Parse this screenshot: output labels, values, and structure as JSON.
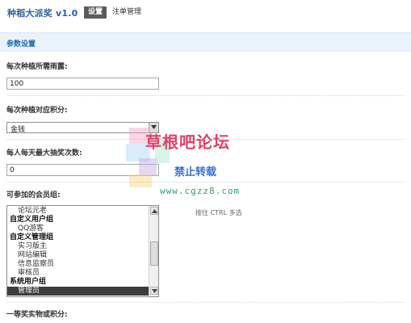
{
  "header": {
    "app_title": "种稻大派奖 v1.0",
    "tabs": [
      {
        "label": "设置",
        "active": true
      },
      {
        "label": "注单管理",
        "active": false
      }
    ]
  },
  "section": {
    "title": "参数设置"
  },
  "fields": {
    "rain_cost": {
      "label": "每次种植所需雨露:",
      "value": "100"
    },
    "points_type": {
      "label": "每次种植对应积分:",
      "selected": "金钱"
    },
    "daily_limit": {
      "label": "每人每天最大抽奖次数:",
      "value": "0"
    },
    "member_groups": {
      "label": "可参加的会员组:",
      "hint": "按住 CTRL 多选",
      "items": [
        {
          "label": "论坛元老",
          "type": "option",
          "selected": false
        },
        {
          "label": "自定义用户组",
          "type": "group",
          "selected": false
        },
        {
          "label": "QQ游客",
          "type": "option",
          "selected": false
        },
        {
          "label": "自定义管理组",
          "type": "group",
          "selected": false
        },
        {
          "label": "实习版主",
          "type": "option",
          "selected": false
        },
        {
          "label": "网站编辑",
          "type": "option",
          "selected": false
        },
        {
          "label": "信息监察员",
          "type": "option",
          "selected": false
        },
        {
          "label": "审核员",
          "type": "option",
          "selected": false
        },
        {
          "label": "系统用户组",
          "type": "group",
          "selected": false
        },
        {
          "label": "管理员",
          "type": "option",
          "selected": true
        }
      ]
    },
    "first_prize": {
      "label": "一等奖实物或积分:"
    }
  },
  "watermark": {
    "title": "草根吧论坛",
    "subtitle": "禁止转载",
    "url": "www.cgzz8.com"
  },
  "colors": {
    "title_blue": "#2f62a0",
    "section_bg": "#eaf3fb",
    "section_text": "#1f6fb0",
    "selected_bg": "#3d3d3d"
  }
}
